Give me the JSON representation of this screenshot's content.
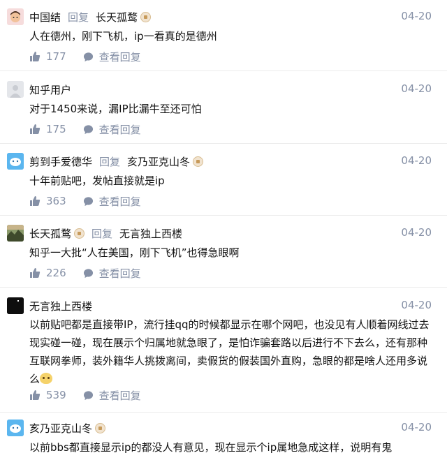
{
  "icons": {
    "like": "thumbs-up-icon",
    "comment": "comment-bubble-icon",
    "badge": "creator-badge-icon"
  },
  "colors": {
    "text": "#121212",
    "meta": "#8590a6",
    "divider": "#ebebeb"
  },
  "comments": [
    {
      "author": "中国结",
      "reply_label": "回复",
      "reply_to": "长天孤鹜",
      "time": "04-20",
      "content": "人在德州，刚下飞机，ip一看真的是德州",
      "likes": "177",
      "view_label": "查看回复"
    },
    {
      "author": "知乎用户",
      "time": "04-20",
      "content": "对于1450来说，漏IP比漏牛至还可怕",
      "likes": "175",
      "view_label": "查看回复"
    },
    {
      "author": "剪到手爱德华",
      "reply_label": "回复",
      "reply_to": "亥乃亚克山冬",
      "time": "04-20",
      "content": "十年前贴吧，发帖直接就是ip",
      "likes": "363",
      "view_label": "查看回复"
    },
    {
      "author": "长天孤鹜",
      "reply_label": "回复",
      "reply_to": "无言独上西楼",
      "time": "04-20",
      "content": "知乎一大批“人在美国，刚下飞机”也得急眼啊",
      "likes": "226",
      "view_label": "查看回复"
    },
    {
      "author": "无言独上西楼",
      "time": "04-20",
      "content_lines": [
        "以前贴吧都是直接带IP，流行挂qq的时候都显示在哪个网吧，也没见有人顺着网线过去",
        "现实碰一碰，现在展示个归属地就急眼了，是怕诈骗套路以后进行不下去么，还有那种",
        "互联网拳师，装外籍华人挑拨离间，卖假货的假装国外直购，急眼的都是啥人还用多说",
        "么"
      ],
      "likes": "539",
      "view_label": "查看回复"
    },
    {
      "author": "亥乃亚克山冬",
      "time": "04-20",
      "content": "以前bbs都直接显示ip的都没人有意见，现在显示个ip属地急成这样，说明有鬼"
    }
  ]
}
